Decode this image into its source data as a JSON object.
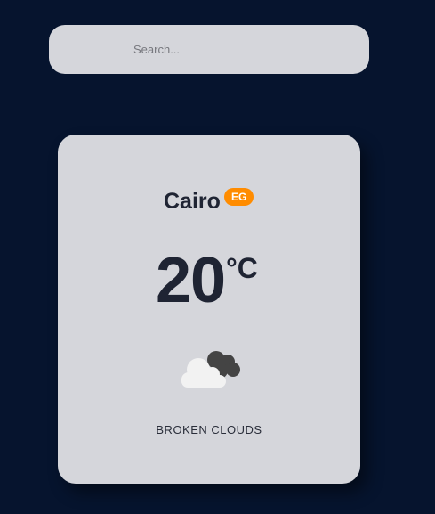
{
  "search": {
    "placeholder": "Search...",
    "value": ""
  },
  "weather": {
    "city": "Cairo",
    "country": "EG",
    "temperature": "20",
    "unit": "°C",
    "icon": "broken-clouds-icon",
    "description": "BROKEN CLOUDS"
  },
  "colors": {
    "background": "#06142e",
    "card": "#d5d6db",
    "badge": "#ff8c00",
    "text": "#1f2433"
  }
}
